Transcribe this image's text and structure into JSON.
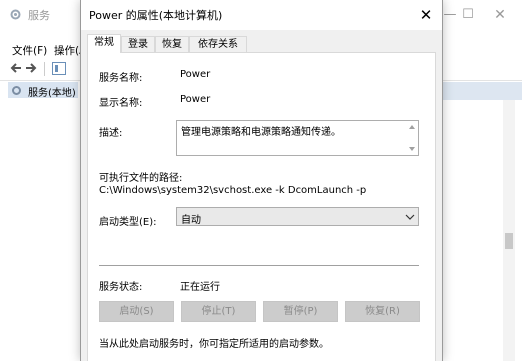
{
  "background_window": {
    "title": "服务",
    "menu": {
      "file": "文件(F)",
      "action": "操作(A)"
    },
    "tree_item": "服务(本地)"
  },
  "dialog": {
    "title": "Power 的属性(本地计算机)",
    "close_glyph": "✕",
    "tabs": [
      "常规",
      "登录",
      "恢复",
      "依存关系"
    ],
    "active_tab": "常规",
    "service_name_label": "服务名称:",
    "service_name": "Power",
    "display_name_label": "显示名称:",
    "display_name": "Power",
    "description_label": "描述:",
    "description": "管理电源策略和电源策略通知传递。",
    "path_label": "可执行文件的路径:",
    "path": "C:\\Windows\\system32\\svchost.exe -k DcomLaunch -p",
    "startup_type_label": "启动类型(E):",
    "startup_type": "自动",
    "service_status_label": "服务状态:",
    "service_status": "正在运行",
    "buttons": {
      "start": "启动(S)",
      "stop": "停止(T)",
      "pause": "暂停(P)",
      "resume": "恢复(R)"
    },
    "hint": "当从此处启动服务时，你可指定所适用的启动参数。"
  },
  "colors": {
    "selection": "#d9e4f1",
    "disabled_button": "#cccccc",
    "dialog_bg": "#f0f0f0"
  }
}
